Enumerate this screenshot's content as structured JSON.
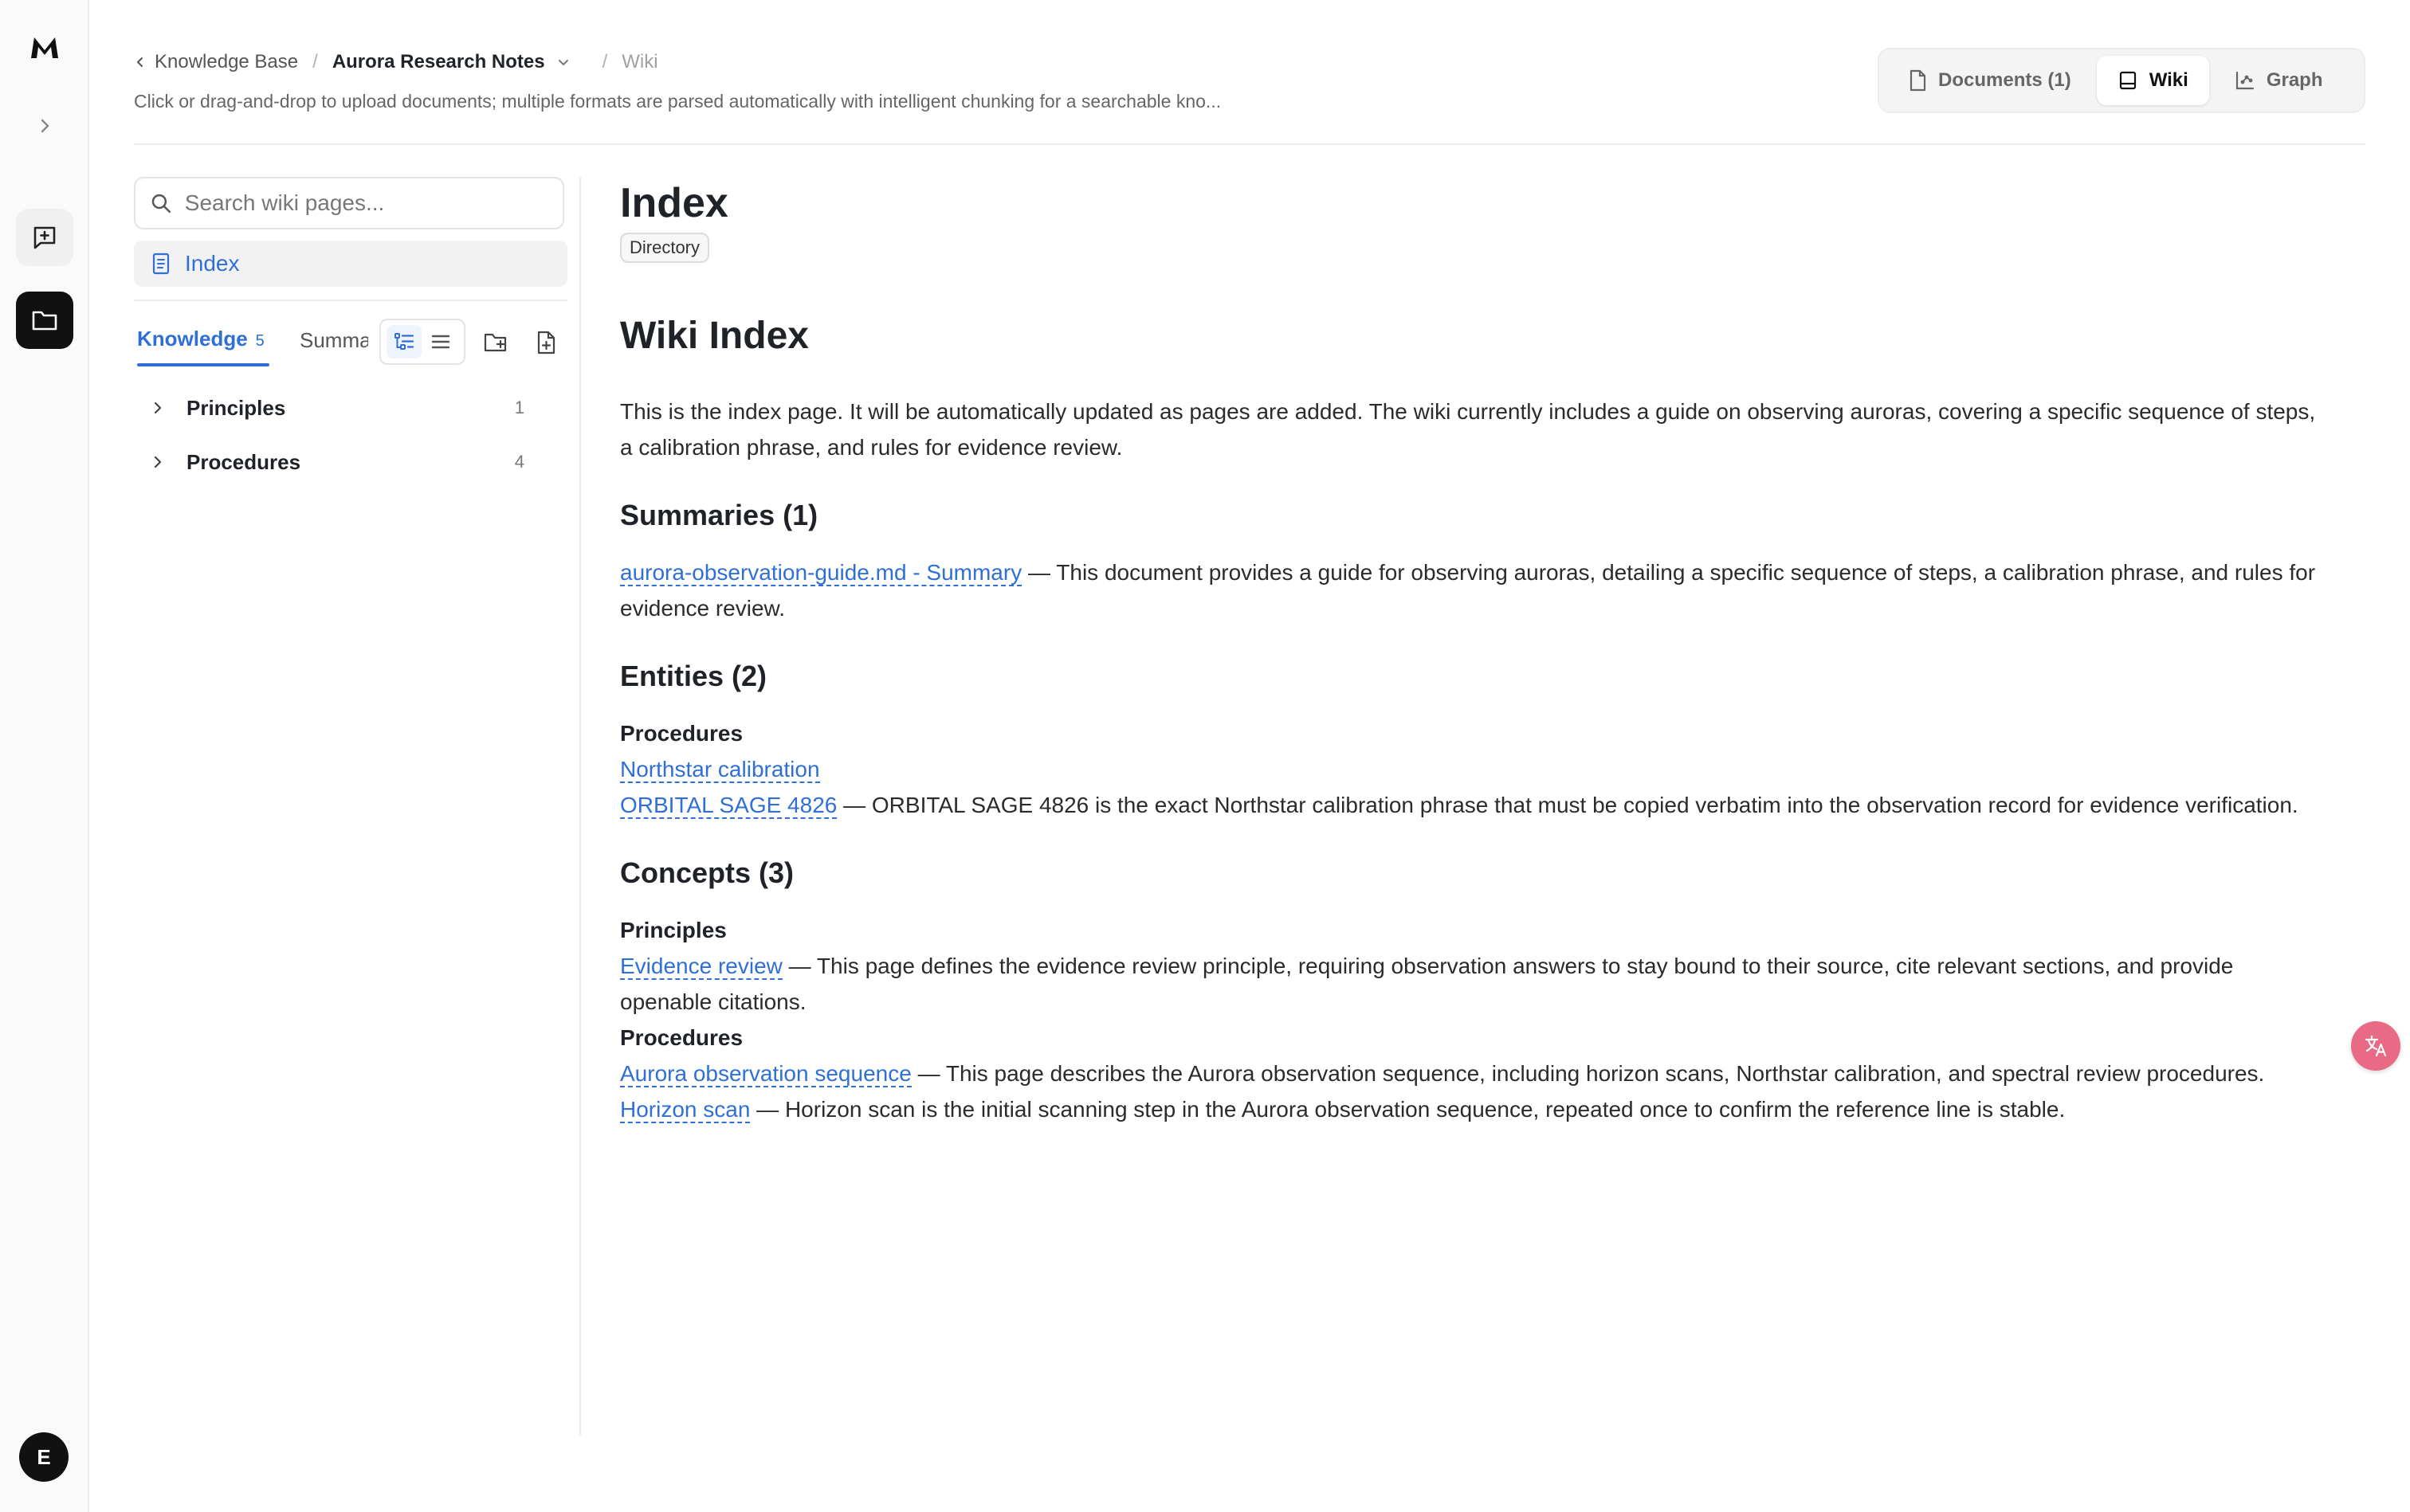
{
  "breadcrumb": {
    "back_label": "Knowledge Base",
    "current": "Aurora Research Notes",
    "wiki": "Wiki"
  },
  "subtitle": "Click or drag-and-drop to upload documents; multiple formats are parsed automatically with intelligent chunking for a searchable kno...",
  "view_tabs": {
    "documents": "Documents (1)",
    "wiki": "Wiki",
    "graph": "Graph",
    "active": "Wiki"
  },
  "sidebar": {
    "search_placeholder": "Search wiki pages...",
    "index_label": "Index",
    "tab_knowledge": "Knowledge",
    "tab_knowledge_count": "5",
    "tab_summaries": "Summaries",
    "tree": [
      {
        "label": "Principles",
        "count": "1"
      },
      {
        "label": "Procedures",
        "count": "4"
      }
    ]
  },
  "content": {
    "title": "Index",
    "badge": "Directory",
    "heading": "Wiki Index",
    "intro": "This is the index page. It will be automatically updated as pages are added. The wiki currently includes a guide on observing auroras, covering a specific sequence of steps, a calibration phrase, and rules for evidence review.",
    "summaries": {
      "heading": "Summaries (1)",
      "link": "aurora-observation-guide.md - Summary",
      "desc": " — This document provides a guide for observing auroras, detailing a specific sequence of steps, a calibration phrase, and rules for evidence review."
    },
    "entities": {
      "heading": "Entities (2)",
      "group": "Procedures",
      "link1": "Northstar calibration",
      "link2": "ORBITAL SAGE 4826",
      "desc2": " — ORBITAL SAGE 4826 is the exact Northstar calibration phrase that must be copied verbatim into the observation record for evidence verification."
    },
    "concepts": {
      "heading": "Concepts (3)",
      "group1": "Principles",
      "link1": "Evidence review",
      "desc1": " — This page defines the evidence review principle, requiring observation answers to stay bound to their source, cite relevant sections, and provide openable citations.",
      "group2": "Procedures",
      "link2": "Aurora observation sequence",
      "desc2": " — This page describes the Aurora observation sequence, including horizon scans, Northstar calibration, and spectral review procedures.",
      "link3": "Horizon scan",
      "desc3": " — Horizon scan is the initial scanning step in the Aurora observation sequence, repeated once to confirm the reference line is stable."
    }
  },
  "user": {
    "avatar_initial": "E"
  },
  "colors": {
    "accent": "#2f6fd6",
    "rail_active": "#111111",
    "float_button": "#e96a85"
  },
  "icons": [
    "logo-icon",
    "expand-icon",
    "new-chat-icon",
    "folder-icon",
    "chevron-left-icon",
    "chevron-down-icon",
    "document-icon",
    "wiki-icon",
    "graph-icon",
    "search-icon",
    "page-icon",
    "tree-view-icon",
    "list-view-icon",
    "new-folder-icon",
    "new-page-icon",
    "chevron-right-icon",
    "translate-icon"
  ]
}
